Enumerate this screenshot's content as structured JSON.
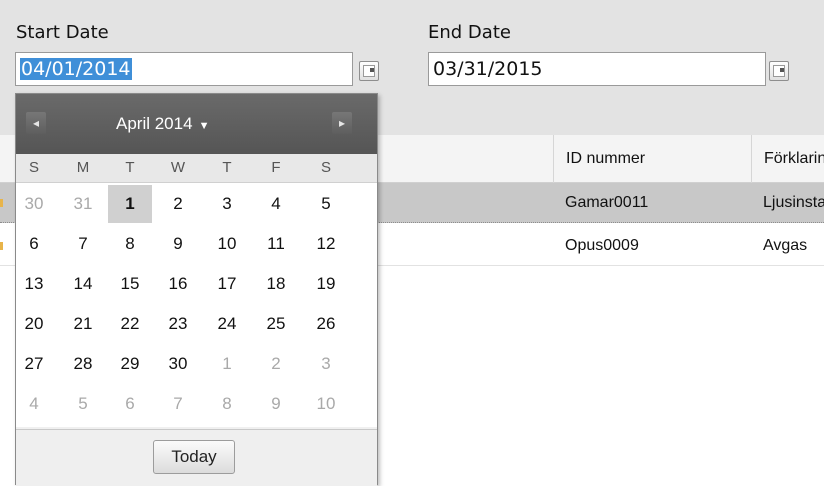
{
  "filters": {
    "start_label": "Start Date",
    "start_value": "04/01/2014",
    "end_label": "End Date",
    "end_value": "03/31/2015"
  },
  "grid": {
    "columns": [
      "ID nummer",
      "Förklaring"
    ],
    "rows": [
      {
        "id": "Gamar0011",
        "desc": "Ljusinstallation",
        "selected": true
      },
      {
        "id": "Opus0009",
        "desc": "Avgas",
        "selected": false
      }
    ]
  },
  "picker": {
    "month_title": "April 2014",
    "prev_icon": "◂",
    "next_icon": "▸",
    "caret": "▼",
    "weekdays": [
      "S",
      "M",
      "T",
      "W",
      "T",
      "F",
      "S"
    ],
    "weeks": [
      [
        {
          "d": "30",
          "m": true
        },
        {
          "d": "31",
          "m": true
        },
        {
          "d": "1",
          "sel": true
        },
        {
          "d": "2"
        },
        {
          "d": "3"
        },
        {
          "d": "4"
        },
        {
          "d": "5"
        }
      ],
      [
        {
          "d": "6"
        },
        {
          "d": "7"
        },
        {
          "d": "8"
        },
        {
          "d": "9"
        },
        {
          "d": "10"
        },
        {
          "d": "11"
        },
        {
          "d": "12"
        }
      ],
      [
        {
          "d": "13"
        },
        {
          "d": "14"
        },
        {
          "d": "15"
        },
        {
          "d": "16"
        },
        {
          "d": "17"
        },
        {
          "d": "18"
        },
        {
          "d": "19"
        }
      ],
      [
        {
          "d": "20"
        },
        {
          "d": "21"
        },
        {
          "d": "22"
        },
        {
          "d": "23"
        },
        {
          "d": "24"
        },
        {
          "d": "25"
        },
        {
          "d": "26"
        }
      ],
      [
        {
          "d": "27"
        },
        {
          "d": "28"
        },
        {
          "d": "29"
        },
        {
          "d": "30"
        },
        {
          "d": "1",
          "m": true
        },
        {
          "d": "2",
          "m": true
        },
        {
          "d": "3",
          "m": true
        }
      ],
      [
        {
          "d": "4",
          "m": true
        },
        {
          "d": "5",
          "m": true
        },
        {
          "d": "6",
          "m": true
        },
        {
          "d": "7",
          "m": true
        },
        {
          "d": "8",
          "m": true
        },
        {
          "d": "9",
          "m": true
        },
        {
          "d": "10",
          "m": true
        }
      ]
    ],
    "today_label": "Today"
  },
  "colors": {
    "selection": "#3f8fd8",
    "band": "#e3e3e3",
    "picker_header": "#5f5f5f"
  }
}
